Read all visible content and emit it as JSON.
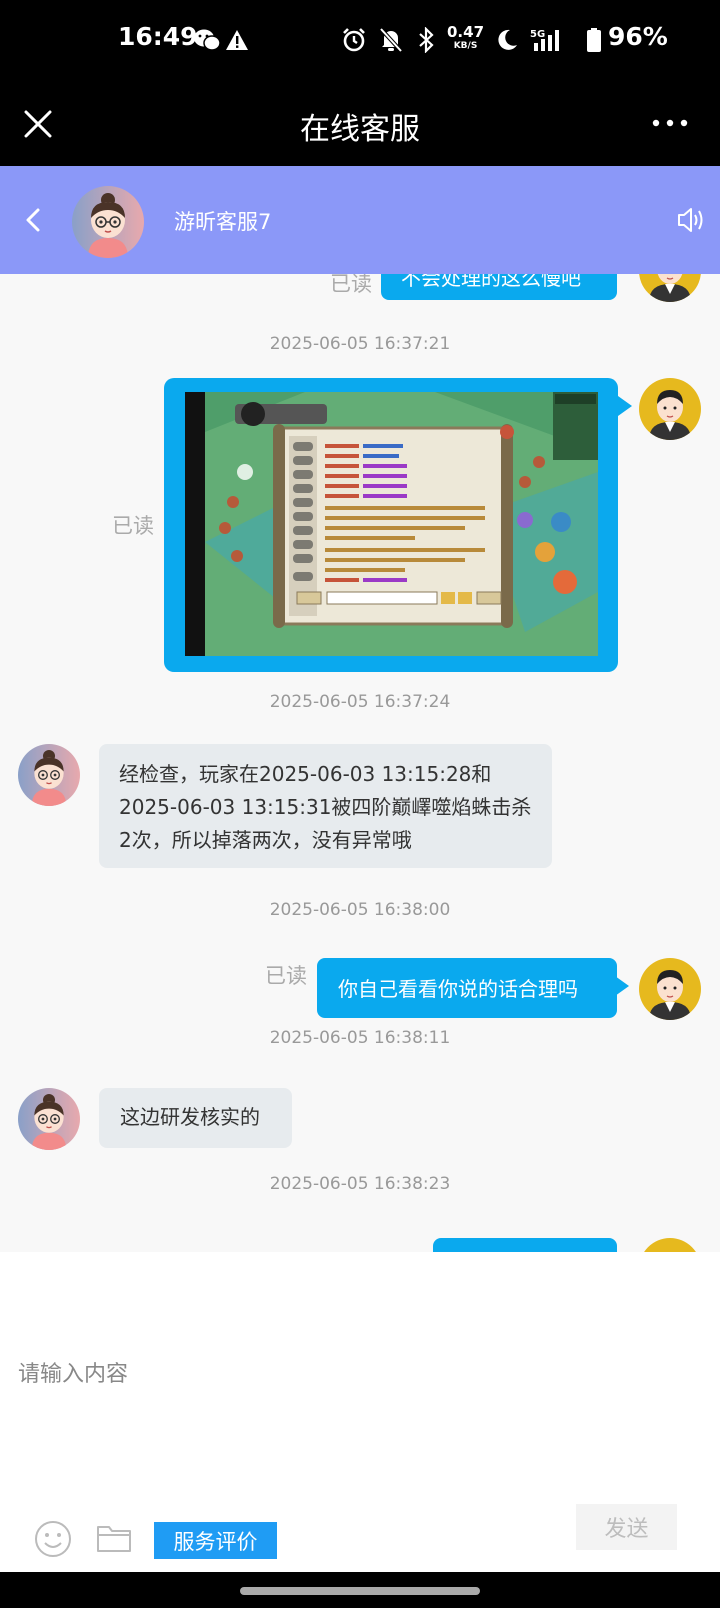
{
  "status_bar": {
    "time": "16:49",
    "net_speed_value": "0.47",
    "net_speed_unit": "KB/S",
    "network": "5G",
    "battery": "96%"
  },
  "title_bar": {
    "title": "在线客服"
  },
  "chat_header": {
    "agent_name": "游昕客服7"
  },
  "messages": {
    "m0_read": "已读",
    "m0_text": "不会处理的这么慢吧",
    "m1_time": "2025-06-05 16:37:21",
    "m1_read": "已读",
    "m2_time": "2025-06-05 16:37:24",
    "m2_line1": "经检查，玩家在2025-06-03 13:15:28和",
    "m2_line2": "2025-06-03 13:15:31被四阶巅嶧噬焰蛛击杀",
    "m2_line3": "2次，所以掉落两次，没有异常哦",
    "m3_time": "2025-06-05 16:38:00",
    "m3_read": "已读",
    "m3_text": "你自己看看你说的话合理吗",
    "m4_time": "2025-06-05 16:38:11",
    "m4_text": "这边研发核实的",
    "m5_time": "2025-06-05 16:38:23"
  },
  "input": {
    "placeholder": "请输入内容",
    "rate_label": "服务评价",
    "send_label": "发送"
  },
  "colors": {
    "header_bg": "#8b98f8",
    "outgoing_bubble": "#0aa9ee",
    "incoming_bubble": "#e7ebee",
    "rate_button": "#1f9cf4"
  }
}
